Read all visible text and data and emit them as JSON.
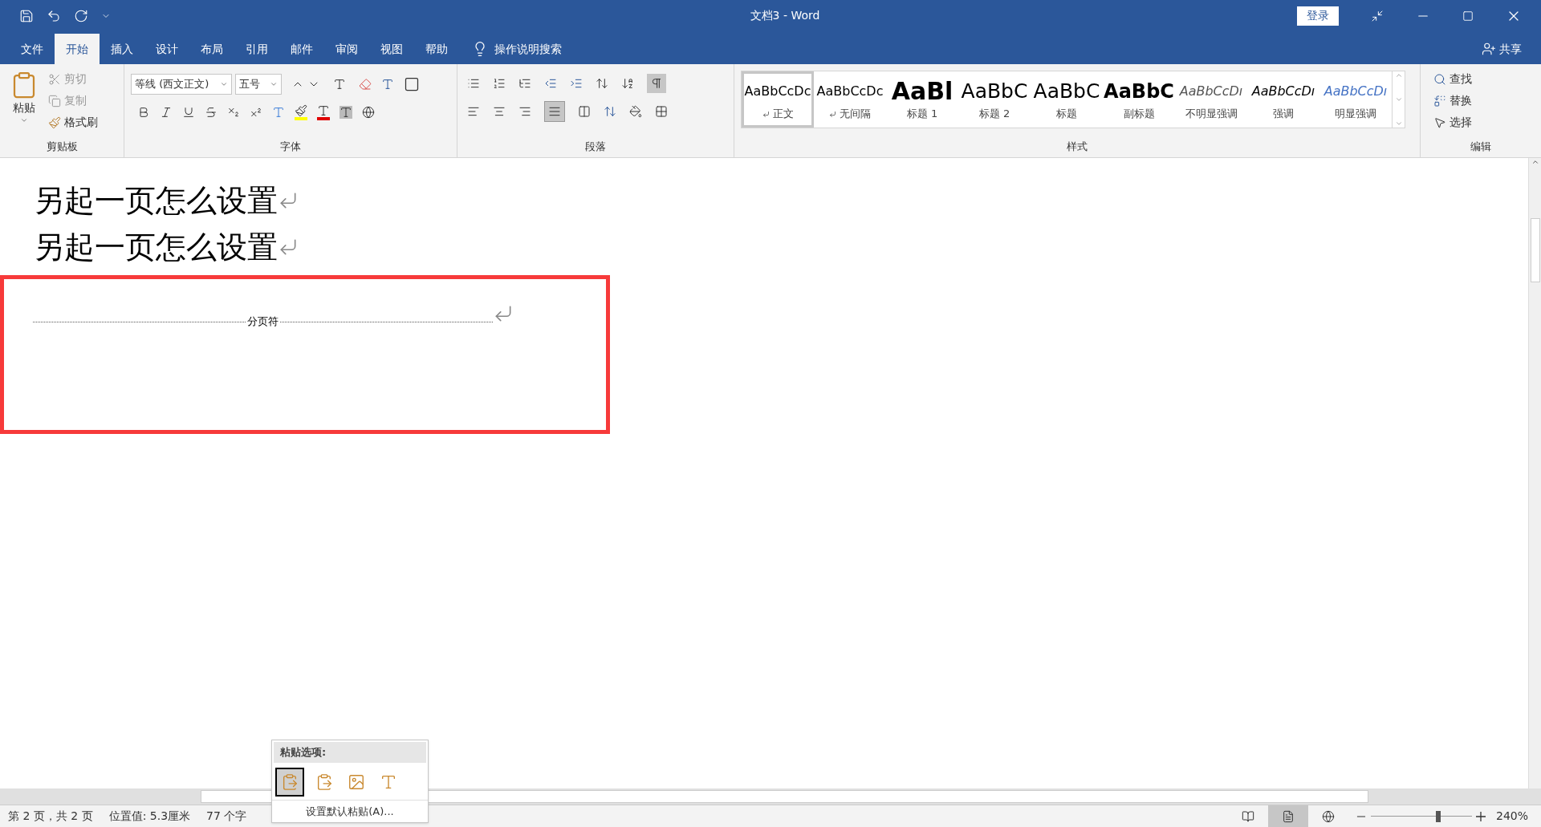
{
  "window": {
    "title": "文档3  -  Word",
    "login": "登录"
  },
  "tabs": [
    {
      "label": "文件",
      "selected": false
    },
    {
      "label": "开始",
      "selected": true
    },
    {
      "label": "插入",
      "selected": false
    },
    {
      "label": "设计",
      "selected": false
    },
    {
      "label": "布局",
      "selected": false
    },
    {
      "label": "引用",
      "selected": false
    },
    {
      "label": "邮件",
      "selected": false
    },
    {
      "label": "审阅",
      "selected": false
    },
    {
      "label": "视图",
      "selected": false
    },
    {
      "label": "帮助",
      "selected": false
    }
  ],
  "tell_me": "操作说明搜索",
  "share": "共享",
  "clipboard": {
    "paste": "粘贴",
    "cut": "剪切",
    "copy": "复制",
    "format_painter": "格式刷",
    "group": "剪贴板"
  },
  "font": {
    "name": "等线 (西文正文)",
    "size": "五号",
    "group": "字体"
  },
  "paragraph": {
    "group": "段落",
    "justify_selected": true
  },
  "styles": {
    "group": "样式",
    "items": [
      {
        "sample": "AaBbCcDc",
        "label": "正文",
        "kind": "normal",
        "mark": true,
        "selected": true
      },
      {
        "sample": "AaBbCcDc",
        "label": "无间隔",
        "kind": "normal",
        "mark": true,
        "selected": false
      },
      {
        "sample": "AaBl",
        "label": "标题 1",
        "kind": "heading",
        "mark": false,
        "selected": false
      },
      {
        "sample": "AaBbC",
        "label": "标题 2",
        "kind": "large",
        "mark": false,
        "selected": false
      },
      {
        "sample": "AaBbC",
        "label": "标题",
        "kind": "large",
        "mark": false,
        "selected": false
      },
      {
        "sample": "AaBbC",
        "label": "副标题",
        "kind": "bold",
        "mark": false,
        "selected": false
      },
      {
        "sample": "AaBbCcDı",
        "label": "不明显强调",
        "kind": "italic-grey",
        "mark": false,
        "selected": false
      },
      {
        "sample": "AaBbCcDı",
        "label": "强调",
        "kind": "italic",
        "mark": false,
        "selected": false
      },
      {
        "sample": "AaBbCcDı",
        "label": "明显强调",
        "kind": "italic-blue",
        "mark": false,
        "selected": false
      }
    ]
  },
  "editing": {
    "find": "查找",
    "replace": "替换",
    "select": "选择",
    "group": "编辑"
  },
  "document": {
    "lines": [
      "另起一页怎么设置",
      "另起一页怎么设置"
    ],
    "page_break": "分页符"
  },
  "paste_options": {
    "title": "粘贴选项:",
    "default": "设置默认粘贴(A)..."
  },
  "status_bar": {
    "page": "第 2 页，共 2 页",
    "position": "位置值: 5.3厘米",
    "words": "77 个字",
    "zoom": "240%",
    "zoom_slider": {
      "level": 0.67
    }
  }
}
